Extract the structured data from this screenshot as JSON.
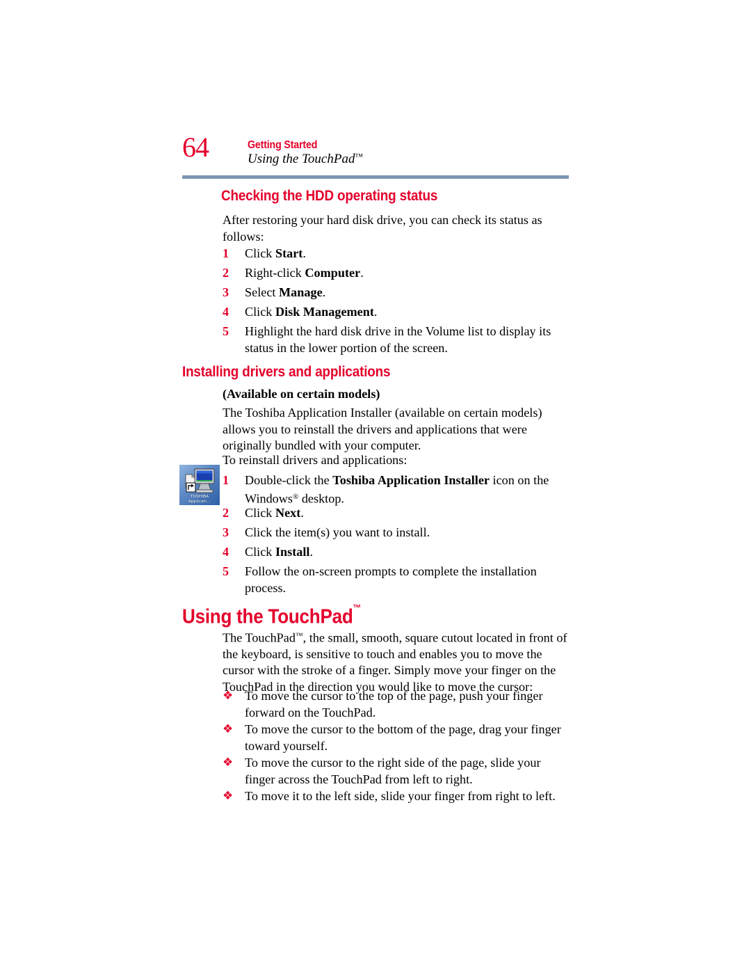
{
  "page": {
    "folio": "64",
    "chapter": "Getting Started",
    "section": "Using the TouchPad",
    "section_tm": "™"
  },
  "divider_color": "#7B96B4",
  "accent_red": "#E4002B",
  "sections": {
    "hdd": {
      "heading": "Checking the HDD operating status",
      "intro": "After restoring your hard disk drive, you can check its status as follows:",
      "steps": [
        {
          "num": "1",
          "pre": "Click ",
          "bold": "Start",
          "post": "."
        },
        {
          "num": "2",
          "pre": "Right-click ",
          "bold": "Computer",
          "post": "."
        },
        {
          "num": "3",
          "pre": "Select ",
          "bold": "Manage",
          "post": "."
        },
        {
          "num": "4",
          "pre": "Click ",
          "bold": "Disk Management",
          "post": "."
        },
        {
          "num": "5",
          "pre": "Highlight the hard disk drive in the Volume list to display its status in the lower portion of the screen.",
          "bold": "",
          "post": ""
        }
      ]
    },
    "drivers": {
      "heading": "Installing drivers and applications",
      "availability": "(Available on certain models)",
      "paragraph": "The Toshiba Application Installer (available on certain models) allows you to reinstall the drivers and applications that were originally bundled with your computer.",
      "lead_in": "To reinstall drivers and applications:",
      "icon": {
        "name": "toshiba-application-installer-icon",
        "caption_line1": "TOSHIBA",
        "caption_line2": "Applicati..."
      },
      "steps": [
        {
          "num": "1",
          "pre": "Double-click the ",
          "bold": "Toshiba Application Installer",
          "post": " icon on the Windows",
          "sup": "®",
          "tail": " desktop."
        },
        {
          "num": "2",
          "pre": "Click ",
          "bold": "Next",
          "post": "."
        },
        {
          "num": "3",
          "pre": "Click the item(s) you want to install.",
          "bold": "",
          "post": ""
        },
        {
          "num": "4",
          "pre": "Click ",
          "bold": "Install",
          "post": "."
        },
        {
          "num": "5",
          "pre": "Follow the on-screen prompts to complete the installation process.",
          "bold": "",
          "post": ""
        }
      ]
    },
    "touchpad": {
      "heading": "Using the TouchPad",
      "heading_tm": "™",
      "paragraph_pre": "The TouchPad",
      "paragraph_sup": "™",
      "paragraph_post": ", the small, smooth, square cutout located in front of the keyboard, is sensitive to touch and enables you to move the cursor with the stroke of a finger. Simply move your finger on the TouchPad in the direction you would like to move the cursor:",
      "bullet_glyph": "❖",
      "bullets": [
        "To move the cursor to the top of the page, push your finger forward on the TouchPad.",
        "To move the cursor to the bottom of the page, drag your finger toward yourself.",
        "To move the cursor to the right side of the page, slide your finger across the TouchPad from left to right.",
        "To move it to the left side, slide your finger from right to left."
      ]
    }
  }
}
